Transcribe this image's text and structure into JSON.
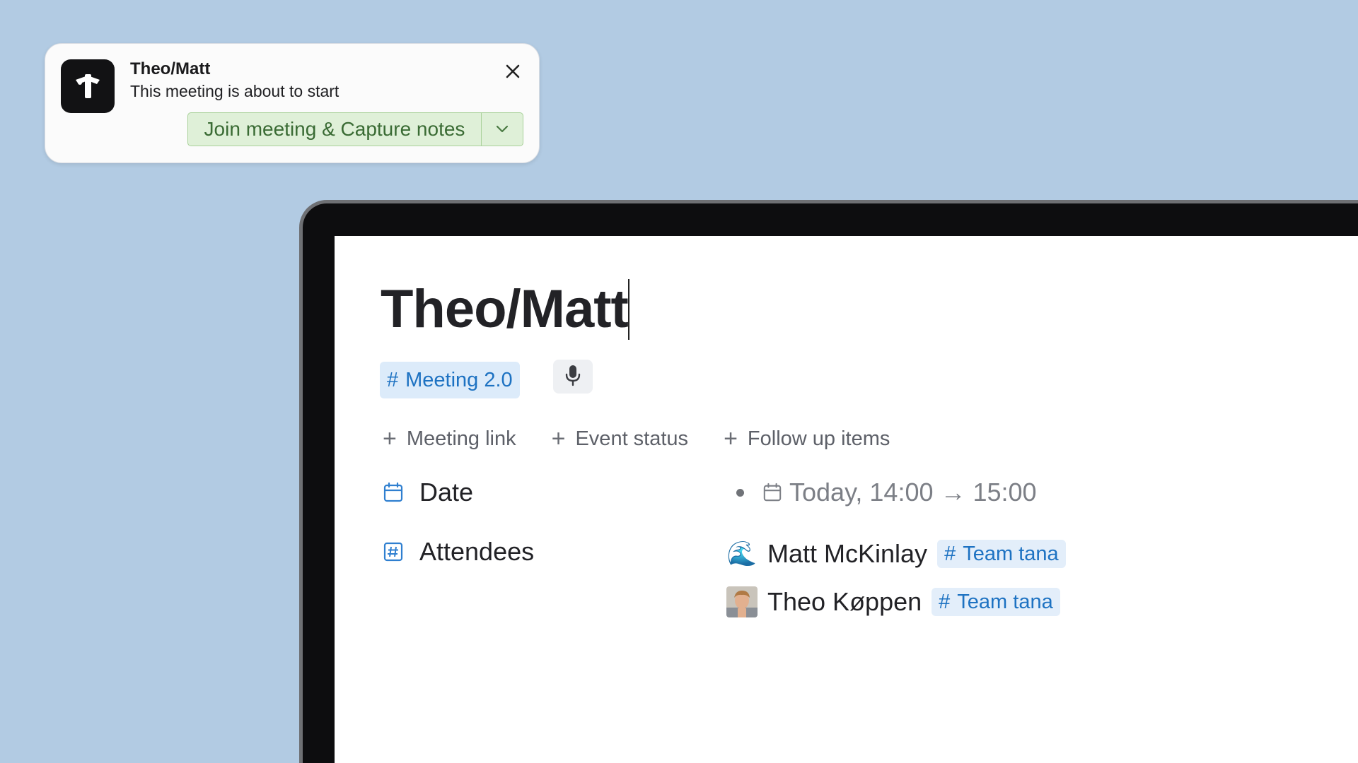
{
  "notification": {
    "app_icon": "tana-logo-icon",
    "title": "Theo/Matt",
    "message": "This meeting is about to start",
    "action_label": "Join meeting & Capture notes",
    "dropdown_icon": "chevron-down-icon",
    "close_icon": "close-icon"
  },
  "page": {
    "title": "Theo/Matt",
    "supertag": {
      "hash": "#",
      "label": "Meeting 2.0"
    },
    "mic_icon": "microphone-icon",
    "add_fields": [
      {
        "plus": "+",
        "label": "Meeting link"
      },
      {
        "plus": "+",
        "label": "Event status"
      },
      {
        "plus": "+",
        "label": "Follow up items"
      }
    ],
    "fields": {
      "date": {
        "label": "Date",
        "icon": "calendar-icon",
        "value": "Today, 14:00 → 15:00"
      },
      "attendees": {
        "label": "Attendees",
        "icon": "hash-field-icon",
        "people": [
          {
            "avatar": "🌊",
            "name": "Matt McKinlay",
            "tag_hash": "#",
            "tag": "Team tana"
          },
          {
            "avatar": "photo-avatar",
            "name": "Theo Køppen",
            "tag_hash": "#",
            "tag": "Team tana"
          }
        ]
      }
    }
  },
  "colors": {
    "background": "#b2cbe3",
    "tag_blue": "#1d72c2",
    "tag_bg": "#dcebfa",
    "action_green_bg": "#dff0d8",
    "action_green_text": "#3a6b34"
  }
}
